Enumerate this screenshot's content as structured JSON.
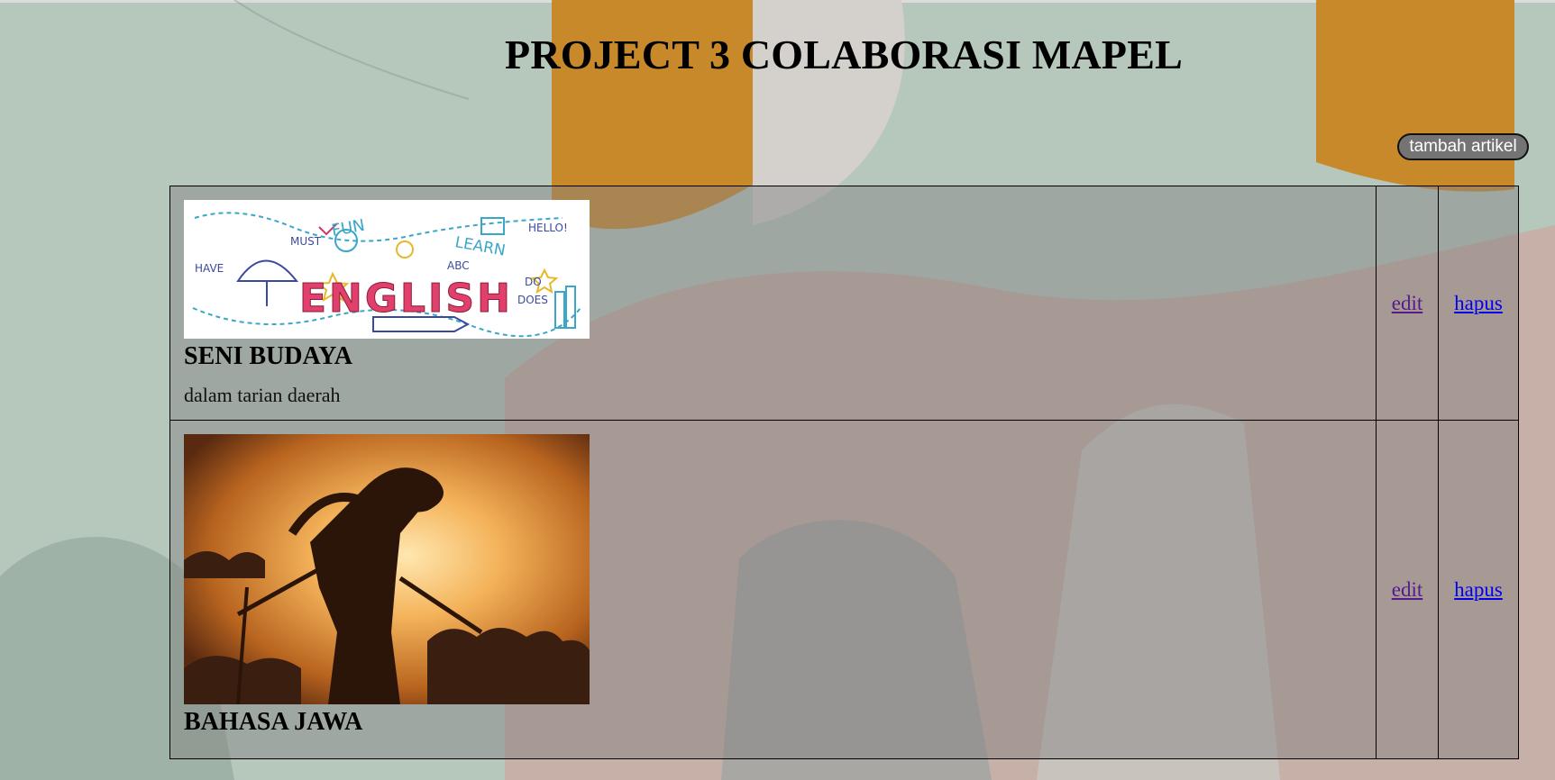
{
  "page": {
    "title": "PROJECT 3 COLABORASI MAPEL",
    "add_button_label": "tambah artikel"
  },
  "articles": [
    {
      "title": "SENI BUDAYA",
      "description": "dalam tarian daerah",
      "image_text": "ENGLISH",
      "doodle_words": [
        "FUN",
        "LEARN",
        "HELLO!",
        "MUST",
        "HAVE",
        "ABC",
        "DO",
        "DOES"
      ],
      "edit_label": "edit",
      "delete_label": "hapus"
    },
    {
      "title": "BAHASA JAWA",
      "description": "",
      "edit_label": "edit",
      "delete_label": "hapus"
    }
  ],
  "colors": {
    "sage": "#b7c8bd",
    "mustard": "#c48a2a",
    "blush": "#c8b0a6",
    "row_overlay": "#808080",
    "visited_link": "#551a8b",
    "link": "#0000ee"
  }
}
